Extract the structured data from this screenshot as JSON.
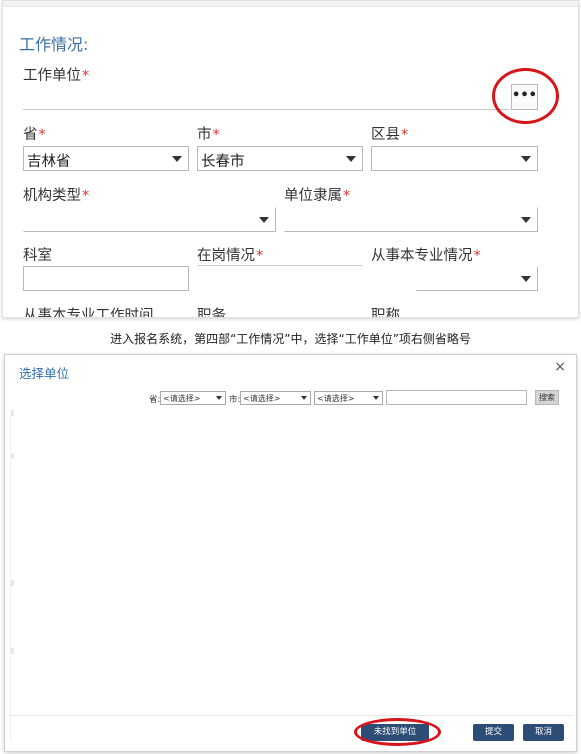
{
  "top_form": {
    "section_title": "工作情况:",
    "required_mark": "*",
    "work_unit_label": "工作单位",
    "ellipsis_label": "•••",
    "province_label": "省",
    "province_value": "吉林省",
    "city_label": "市",
    "city_value": "长春市",
    "district_label": "区县",
    "district_value": "",
    "org_type_label": "机构类型",
    "org_type_value": "",
    "unit_affiliation_label": "单位隶属",
    "unit_affiliation_value": "",
    "department_label": "科室",
    "on_duty_label": "在岗情况",
    "major_work_label": "从事本专业情况",
    "cut_label_1": "从事本专业工作时间",
    "cut_label_2": "职务",
    "cut_label_3": "职称"
  },
  "caption": "进入报名系统，第四部“工作情况”中，选择“工作单位”项右侧省略号",
  "dialog": {
    "title": "选择单位",
    "close_label": "×",
    "province_label": "省:",
    "province_select": "<请选择>",
    "city_label": "市:",
    "city_select": "<请选择>",
    "district_select": "<请选择>",
    "search_input_value": "",
    "search_button_label": "搜索",
    "not_found_button_label": "未找到单位",
    "submit_button_label": "提交",
    "cancel_button_label": "取消"
  },
  "colors": {
    "required": "#e0312f",
    "section_title": "#3a6ea5",
    "dialog_title": "#2f6fb0",
    "button_bg": "#2d4d77",
    "annotation_circle": "#d8141b"
  }
}
